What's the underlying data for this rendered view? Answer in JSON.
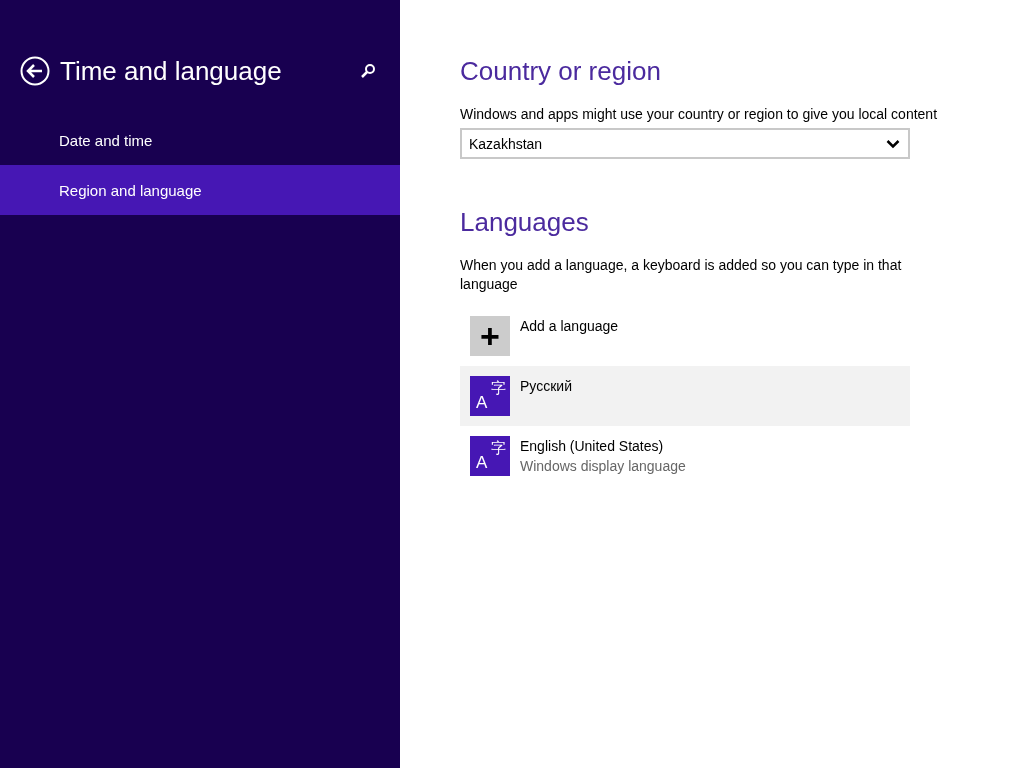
{
  "sidebar": {
    "title": "Time and language",
    "items": [
      {
        "label": "Date and time",
        "selected": false
      },
      {
        "label": "Region and language",
        "selected": true
      }
    ]
  },
  "country": {
    "heading": "Country or region",
    "description": "Windows and apps might use your country or region to give you local content",
    "value": "Kazakhstan"
  },
  "languages": {
    "heading": "Languages",
    "description": "When you add a language, a keyboard is added so you can type in that language",
    "add": {
      "icon": "+",
      "label": "Add a language"
    },
    "items": [
      {
        "icon_letter": "A",
        "icon_character": "字",
        "name": "Русский",
        "selected": true
      },
      {
        "icon_letter": "A",
        "icon_character": "字",
        "name": "English (United States)",
        "subtitle": "Windows display language",
        "selected": false
      }
    ]
  }
}
